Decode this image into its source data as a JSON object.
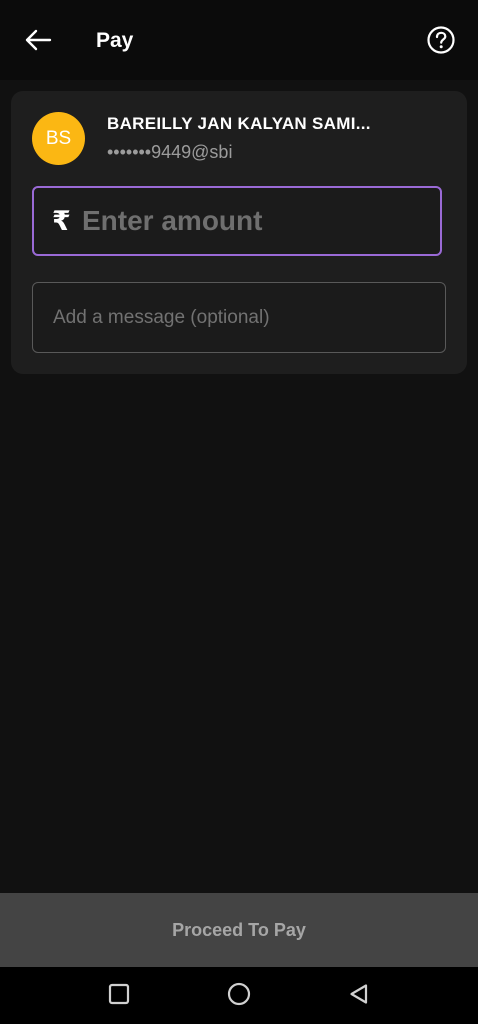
{
  "header": {
    "title": "Pay",
    "back_icon": "arrow-left-icon",
    "help_icon": "help-circle-icon"
  },
  "payee": {
    "avatar_initials": "BS",
    "avatar_color": "#fbb713",
    "name": "BAREILLY JAN KALYAN SAMI...",
    "upi_id": "•••••••9449@sbi"
  },
  "amount": {
    "currency_symbol": "₹",
    "placeholder": "Enter amount",
    "value": ""
  },
  "message": {
    "placeholder": "Add a message (optional)",
    "value": ""
  },
  "actions": {
    "proceed_label": "Proceed To Pay"
  },
  "system_nav": {
    "recents_icon": "square-icon",
    "home_icon": "circle-icon",
    "back_icon": "triangle-back-icon"
  },
  "colors": {
    "focus_border": "#9a6ad6",
    "button_bg": "#444444"
  }
}
